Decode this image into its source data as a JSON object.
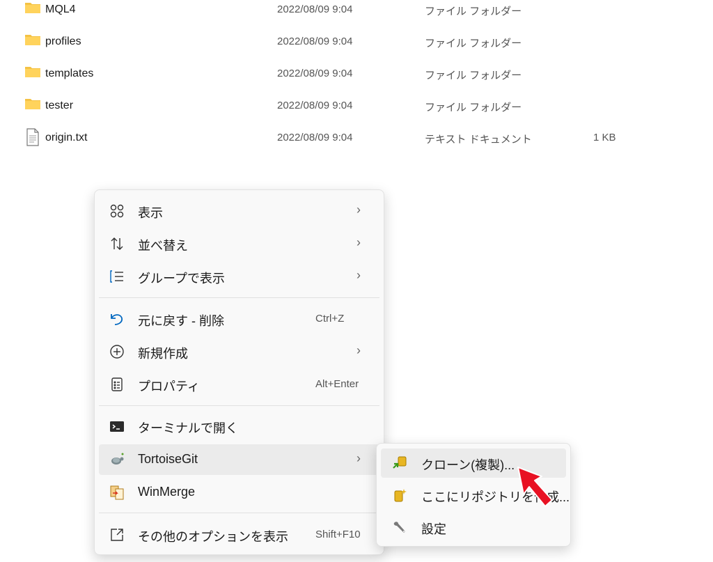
{
  "files": [
    {
      "name": "MQL4",
      "date": "2022/08/09 9:04",
      "type": "ファイル フォルダー",
      "size": "",
      "icon": "folder-icon"
    },
    {
      "name": "profiles",
      "date": "2022/08/09 9:04",
      "type": "ファイル フォルダー",
      "size": "",
      "icon": "folder-icon"
    },
    {
      "name": "templates",
      "date": "2022/08/09 9:04",
      "type": "ファイル フォルダー",
      "size": "",
      "icon": "folder-icon"
    },
    {
      "name": "tester",
      "date": "2022/08/09 9:04",
      "type": "ファイル フォルダー",
      "size": "",
      "icon": "folder-icon"
    },
    {
      "name": "origin.txt",
      "date": "2022/08/09 9:04",
      "type": "テキスト ドキュメント",
      "size": "1 KB",
      "icon": "text-file-icon"
    }
  ],
  "context_menu": {
    "items": [
      {
        "label": "表示",
        "icon": "view-grid-icon",
        "submenu": true
      },
      {
        "label": "並べ替え",
        "icon": "sort-icon",
        "submenu": true
      },
      {
        "label": "グループで表示",
        "icon": "group-list-icon",
        "submenu": true
      },
      {
        "label": "元に戻す - 削除",
        "icon": "undo-icon",
        "shortcut": "Ctrl+Z"
      },
      {
        "label": "新規作成",
        "icon": "new-plus-icon",
        "submenu": true
      },
      {
        "label": "プロパティ",
        "icon": "properties-icon",
        "shortcut": "Alt+Enter"
      },
      {
        "label": "ターミナルで開く",
        "icon": "terminal-icon"
      },
      {
        "label": "TortoiseGit",
        "icon": "tortoisegit-icon",
        "submenu": true,
        "highlighted": true
      },
      {
        "label": "WinMerge",
        "icon": "winmerge-icon"
      },
      {
        "label": "その他のオプションを表示",
        "icon": "more-options-icon",
        "shortcut": "Shift+F10"
      }
    ]
  },
  "tortoisegit_submenu": {
    "items": [
      {
        "label": "クローン(複製)...",
        "icon": "git-clone-icon",
        "highlighted": true
      },
      {
        "label": "ここにリポジトリを作成...",
        "icon": "create-repo-icon"
      },
      {
        "label": "設定",
        "icon": "settings-wrench-icon"
      }
    ]
  },
  "colors": {
    "folder": "#f4c244",
    "accent_cursor": "#e81123",
    "hover": "#ebebeb",
    "menu_bg": "#f9f9f9"
  }
}
